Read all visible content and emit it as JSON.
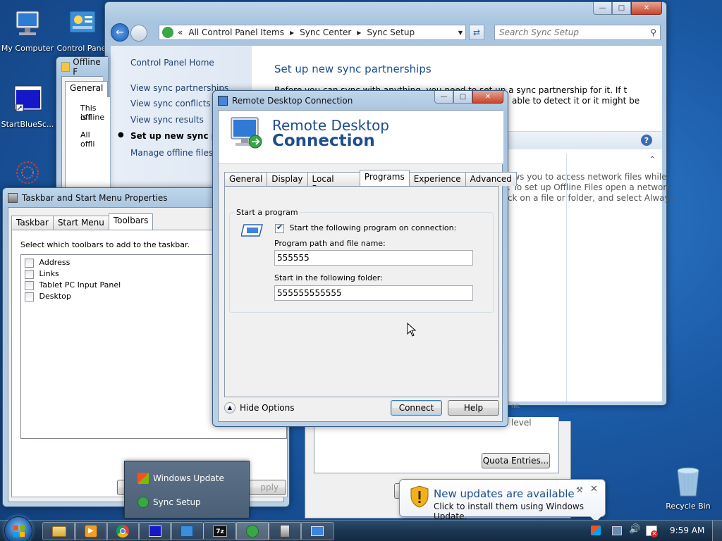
{
  "desktop": {
    "icons": [
      {
        "label": "My Computer"
      },
      {
        "label": "Control Panel"
      },
      {
        "label": "StartBlueSc..."
      },
      {
        "label": "Recycle Bin"
      }
    ]
  },
  "sync_window": {
    "address": {
      "sep": "«",
      "crumbs": [
        "All Control Panel Items",
        "Sync Center",
        "Sync Setup"
      ]
    },
    "search_placeholder": "Search Sync Setup",
    "sidebar": {
      "home": "Control Panel Home",
      "links": [
        "View sync partnerships",
        "View sync conflicts",
        "View sync results",
        "Set up new sync partnerships",
        "Manage offline files"
      ]
    },
    "heading": "Set up new sync partnerships",
    "body_line1": "Before you can sync with anything, you need to set up a sync partnership for it. If the item you",
    "body_line2": "able to detect it or it might be",
    "offline_line1": "ows you to access network files while",
    "offline_line2": ". To set up Offline Files open a network",
    "offline_line3": "ck on a file or folder, and select Alway..."
  },
  "offline_window": {
    "title": "Offline F",
    "tab": "General",
    "line1": "This is l",
    "line2": "offline",
    "line3": "All offli"
  },
  "partial_window": {
    "text1": "nit",
    "text2": "level",
    "quota_button": "Quota Entries..."
  },
  "taskbar_props": {
    "title": "Taskbar and Start Menu Properties",
    "tabs": [
      "Taskbar",
      "Start Menu",
      "Toolbars"
    ],
    "instruction": "Select which toolbars to add to the taskbar.",
    "toolbars": [
      {
        "label": "Address",
        "checked": false
      },
      {
        "label": "Links",
        "checked": false
      },
      {
        "label": "Tablet PC Input Panel",
        "checked": false
      },
      {
        "label": "Desktop",
        "checked": false
      }
    ],
    "apply": "pply"
  },
  "rdc": {
    "title": "Remote Desktop Connection",
    "banner_line1": "Remote Desktop",
    "banner_line2": "Connection",
    "tabs": [
      "General",
      "Display",
      "Local Resources",
      "Programs",
      "Experience",
      "Advanced"
    ],
    "active_tab": "Programs",
    "group_label": "Start a program",
    "start_checkbox_label": "Start the following program on connection:",
    "start_checked": true,
    "path_label": "Program path and file name:",
    "path_value": "555555",
    "folder_label": "Start in the following folder:",
    "folder_value": "555555555555",
    "hide_options": "Hide Options",
    "connect": "Connect",
    "help": "Help"
  },
  "jumplist": {
    "items": [
      "Windows Update",
      "Sync Setup"
    ]
  },
  "balloon": {
    "title": "New updates are available",
    "body": "Click to install them using Windows Update."
  },
  "clock": "9:59 AM",
  "colors": {
    "link": "#1e50a2",
    "heading": "#1e4e8c",
    "desktop": "#1b5aa6"
  }
}
